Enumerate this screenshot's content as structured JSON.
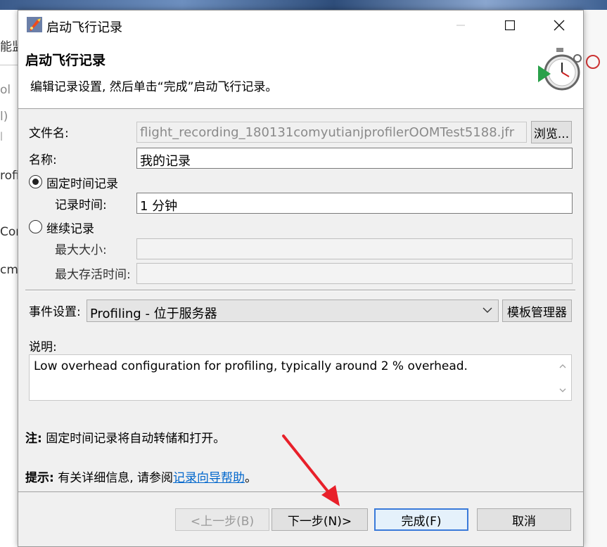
{
  "background": {
    "fragments": [
      "能监",
      "ol",
      "l)",
      "|",
      "rofi",
      "Con",
      "cmd"
    ]
  },
  "titlebar": {
    "title": "启动飞行记录"
  },
  "header": {
    "title": "启动飞行记录",
    "description": "编辑记录设置, 然后单击“完成”启动飞行记录。"
  },
  "form": {
    "filename_label": "文件名:",
    "filename_value": "flight_recording_180131comyutianjprofilerOOMTest5188.jfr",
    "browse_label": "浏览...",
    "name_label": "名称:",
    "name_value": "我的记录",
    "fixed_time_label": "固定时间记录",
    "fixed_time_selected": true,
    "record_time_label": "记录时间:",
    "record_time_value": "1 分钟",
    "continuous_label": "继续记录",
    "continuous_selected": false,
    "max_size_label": "最大大小:",
    "max_size_value": "",
    "max_age_label": "最大存活时间:",
    "max_age_value": "",
    "event_settings_label": "事件设置:",
    "event_settings_value": "Profiling - 位于服务器",
    "template_manager_label": "模板管理器",
    "description_label": "说明:",
    "description_value": "Low overhead configuration for profiling, typically around 2 % overhead."
  },
  "notes": {
    "note_label": "注:",
    "note_text": "固定时间记录将自动转储和打开。",
    "hint_label": "提示:",
    "hint_text": "有关详细信息, 请参阅",
    "hint_link": "记录向导帮助",
    "hint_end": "。"
  },
  "footer": {
    "back_label": "<上一步(B)",
    "next_label": "下一步(N)>",
    "finish_label": "完成(F)",
    "cancel_label": "取消"
  },
  "colors": {
    "accent": "#3a7ad9",
    "link": "#0066cc",
    "annotation_arrow": "#e8202a"
  },
  "icons": [
    "app-rocket-icon",
    "minimize-icon",
    "maximize-icon",
    "close-icon",
    "stopwatch-record-icon",
    "chevron-down-icon",
    "scroll-up-icon",
    "scroll-down-icon"
  ]
}
